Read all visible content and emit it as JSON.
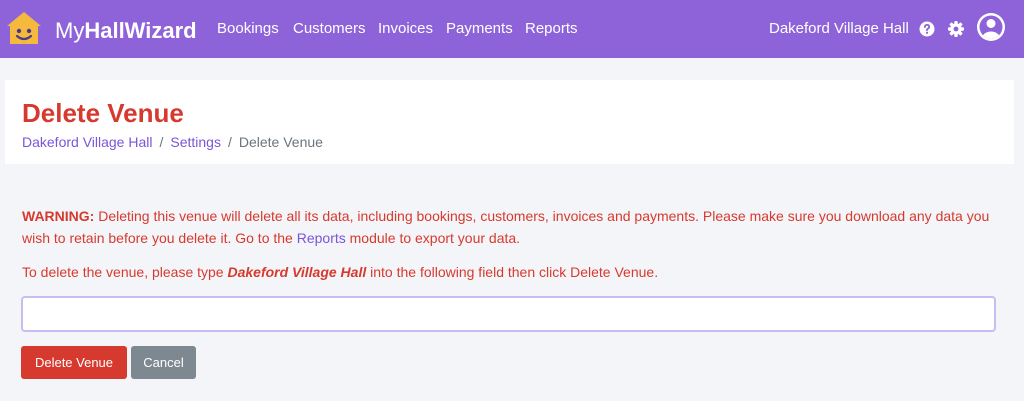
{
  "brand": {
    "name_light": "My",
    "name_bold": "HallWizard",
    "logo_icon": "house-smiley-icon"
  },
  "nav": [
    {
      "label": "Bookings"
    },
    {
      "label": "Customers"
    },
    {
      "label": "Invoices"
    },
    {
      "label": "Payments"
    },
    {
      "label": "Reports"
    }
  ],
  "user_menu": {
    "venue": "Dakeford Village Hall",
    "icons": [
      "help-icon",
      "gear-icon",
      "user-avatar-icon"
    ]
  },
  "page": {
    "title": "Delete Venue",
    "breadcrumb": [
      {
        "label": "Dakeford Village Hall"
      },
      {
        "label": "Settings"
      },
      {
        "label": "Delete Venue"
      }
    ],
    "breadcrumb_separator": "/"
  },
  "warning": {
    "label": "WARNING:",
    "text_before_link": " Deleting this venue will delete all its data, including bookings, customers, invoices and payments. Please make sure you download any data you wish to retain before you delete it. Go to the ",
    "link": "Reports",
    "text_after_link": " module to export your data."
  },
  "instruction": {
    "before": "To delete the venue, please type ",
    "venue_name": "Dakeford Village Hall",
    "after": " into the following field then click Delete Venue."
  },
  "confirm_field": {
    "value": "",
    "placeholder": ""
  },
  "buttons": {
    "delete": "Delete Venue",
    "cancel": "Cancel"
  },
  "colors": {
    "navbar": "#8e63da",
    "danger": "#d63a2f",
    "link": "#7b55d6",
    "secondary": "#7e8890",
    "logo": "#f5b93d"
  }
}
